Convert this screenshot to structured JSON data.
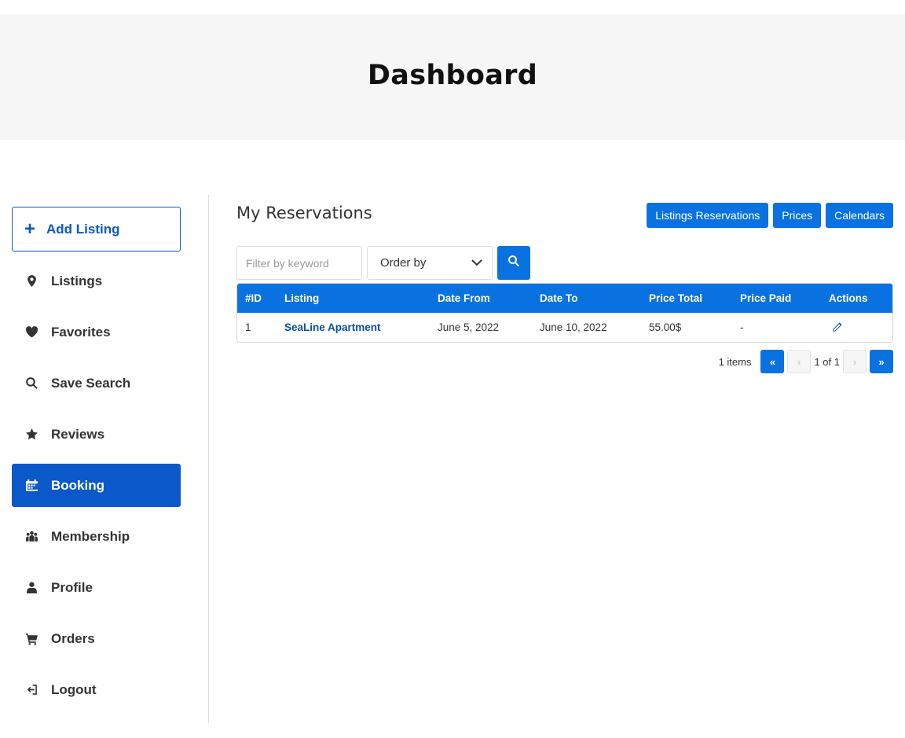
{
  "hero": {
    "title": "Dashboard"
  },
  "sidebar": {
    "add_listing": "Add Listing",
    "items": [
      {
        "label": "Listings",
        "icon": "map-pin-icon"
      },
      {
        "label": "Favorites",
        "icon": "heart-icon"
      },
      {
        "label": "Save Search",
        "icon": "search-icon"
      },
      {
        "label": "Reviews",
        "icon": "star-icon"
      },
      {
        "label": "Booking",
        "icon": "calendar-icon",
        "active": true
      },
      {
        "label": "Membership",
        "icon": "users-icon"
      },
      {
        "label": "Profile",
        "icon": "user-icon"
      },
      {
        "label": "Orders",
        "icon": "cart-icon"
      },
      {
        "label": "Logout",
        "icon": "logout-icon"
      }
    ]
  },
  "main": {
    "title": "My Reservations",
    "buttons": {
      "listings_reservations": "Listings Reservations",
      "prices": "Prices",
      "calendars": "Calendars"
    },
    "filter": {
      "placeholder": "Filter by keyword",
      "order_by": "Order by"
    },
    "table": {
      "headers": [
        "#ID",
        "Listing",
        "Date From",
        "Date To",
        "Price Total",
        "Price Paid",
        "Actions"
      ],
      "rows": [
        {
          "id": "1",
          "listing": "SeaLine Apartment",
          "date_from": "June 5, 2022",
          "date_to": "June 10, 2022",
          "price_total": "55.00$",
          "price_paid": "-"
        }
      ]
    },
    "pagination": {
      "count": "1 items",
      "first": "«",
      "prev": "‹",
      "pages": "1 of 1",
      "next": "›",
      "last": "»"
    }
  },
  "colors": {
    "accent": "#0a72e0",
    "active_nav": "#0a58ca",
    "hero_bg": "#f6f6f6"
  }
}
